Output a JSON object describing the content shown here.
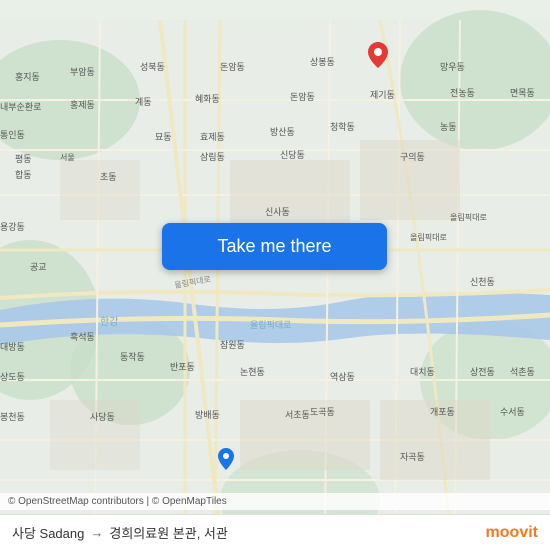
{
  "map": {
    "background_color": "#e8f0e8",
    "attribution": "© OpenStreetMap contributors | © OpenMapTiles"
  },
  "button": {
    "label": "Take me there"
  },
  "bottom_bar": {
    "origin": "사당 Sadang",
    "arrow": "→",
    "destination": "경희의료원 본관, 서관"
  },
  "moovit": {
    "logo_text": "moovit"
  },
  "pin": {
    "color": "#e53935"
  },
  "dest_pin": {
    "color": "#1a73e8"
  }
}
